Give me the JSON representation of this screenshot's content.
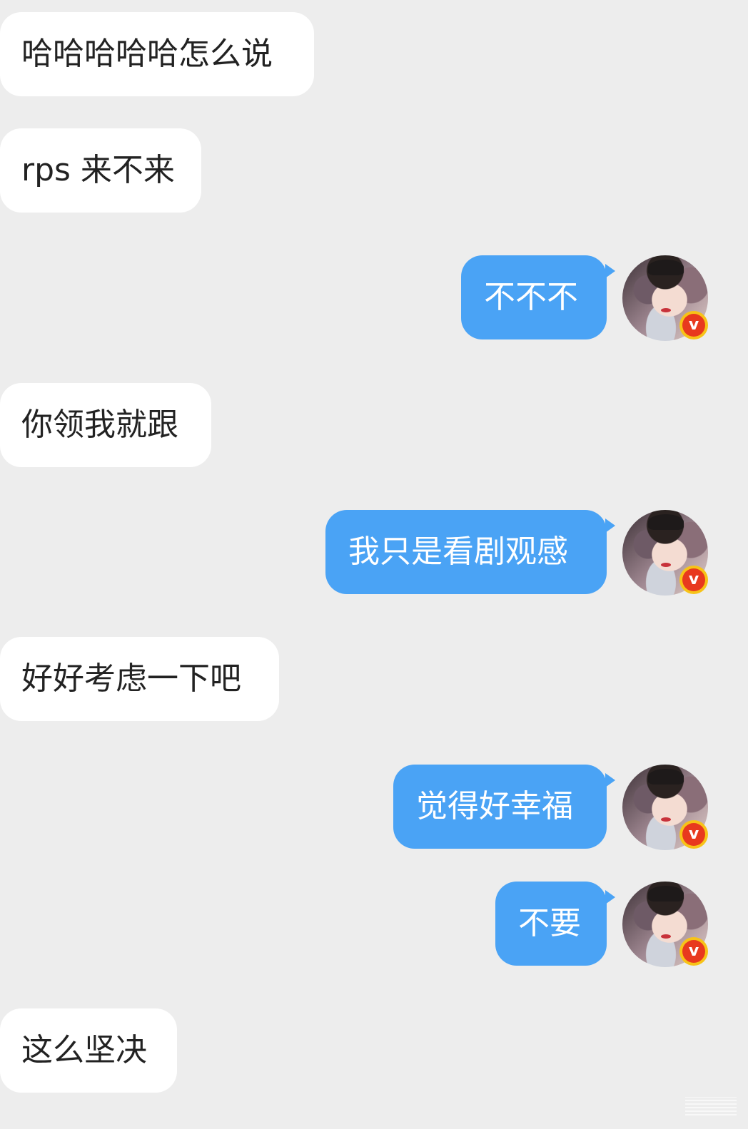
{
  "conversation": {
    "messages": [
      {
        "side": "in",
        "text": "哈哈哈哈哈怎么说"
      },
      {
        "side": "in",
        "text": "rps 来不来"
      },
      {
        "side": "out",
        "text": "不不不",
        "avatar": "user-avatar",
        "badge": "v"
      },
      {
        "side": "in",
        "text": "你领我就跟"
      },
      {
        "side": "out",
        "text": "我只是看剧观感",
        "avatar": "user-avatar",
        "badge": "v"
      },
      {
        "side": "in",
        "text": "好好考虑一下吧"
      },
      {
        "side": "out",
        "text": "觉得好幸福",
        "avatar": "user-avatar",
        "badge": "v"
      },
      {
        "side": "out",
        "text": "不要",
        "avatar": "user-avatar",
        "badge": "v"
      },
      {
        "side": "in",
        "text": "这么坚决"
      }
    ]
  },
  "colors": {
    "background": "#ededed",
    "incoming_bubble": "#ffffff",
    "outgoing_bubble": "#4aa3f5",
    "badge_ring": "#f7c318",
    "badge_fill": "#e8391e"
  },
  "icons": {
    "avatar": "portrait-avatar",
    "verified_badge": "verified-v-icon"
  }
}
